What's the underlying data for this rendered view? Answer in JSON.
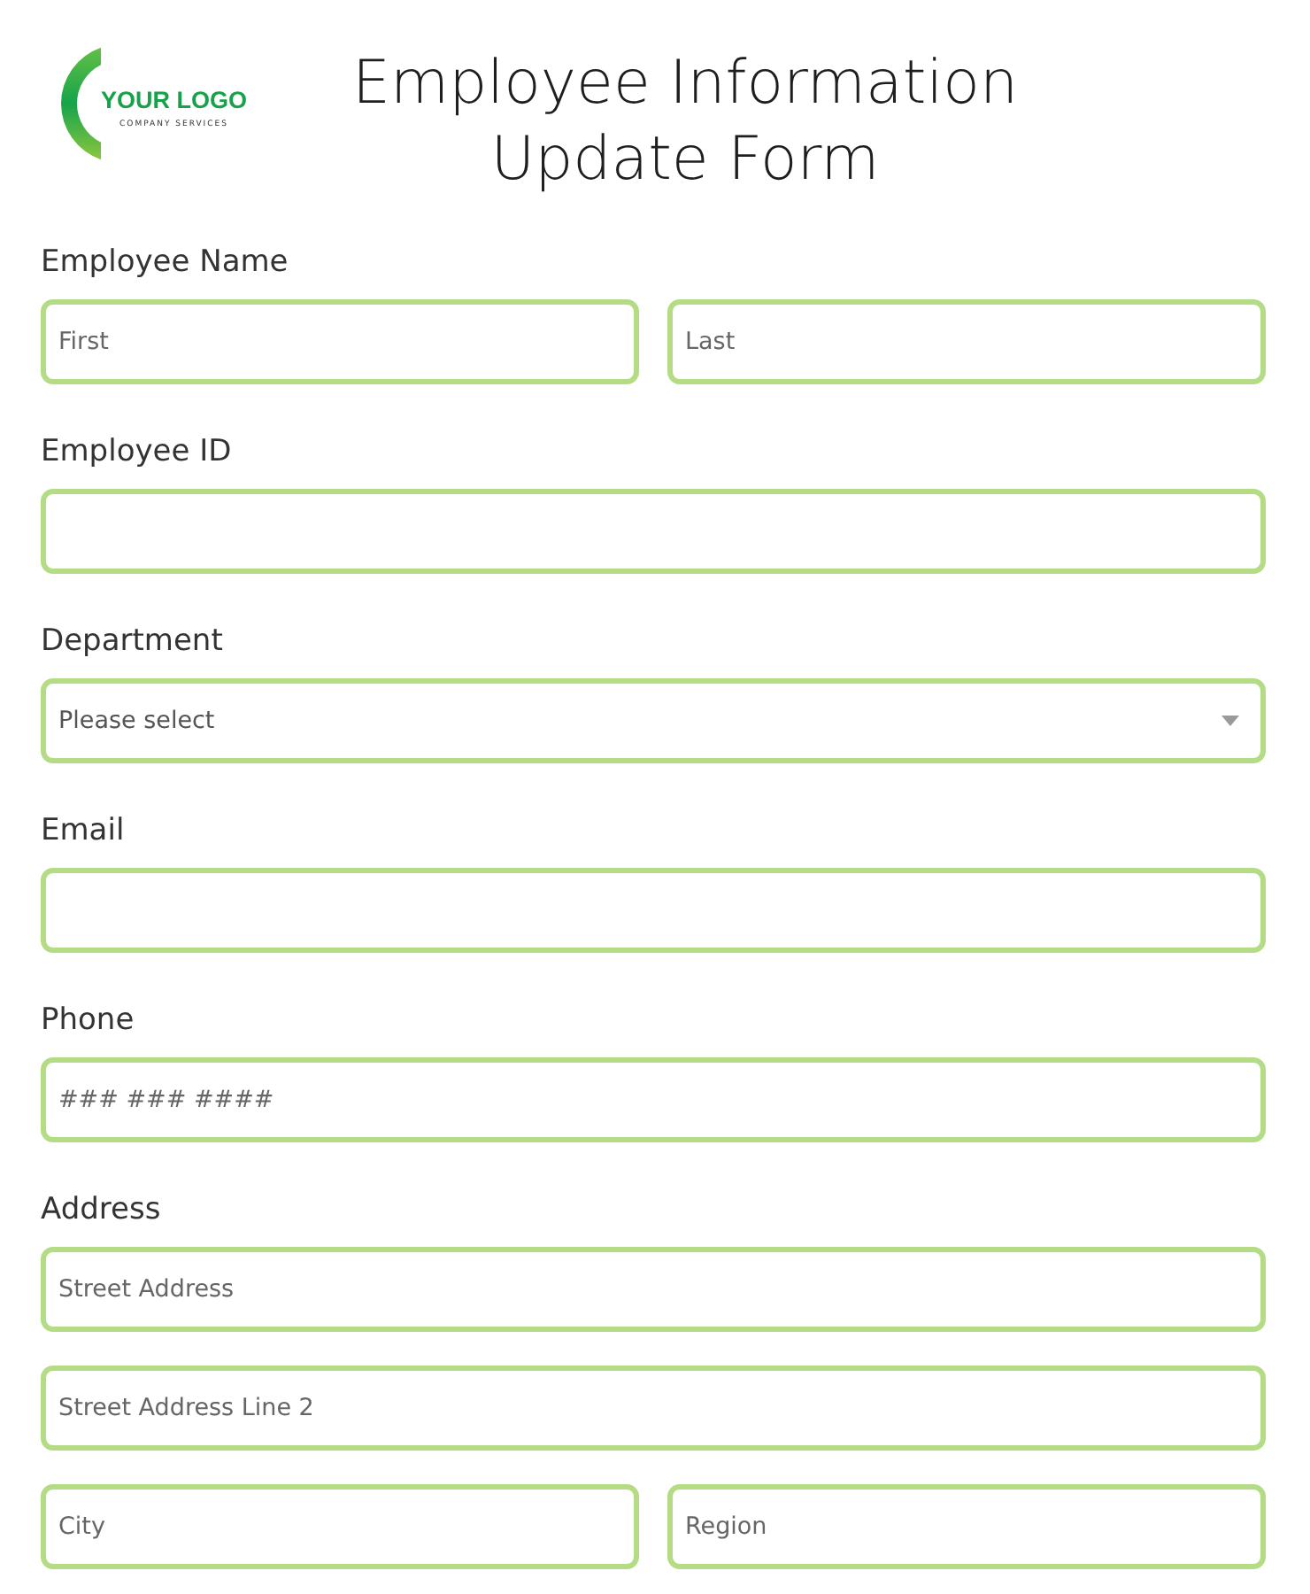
{
  "header": {
    "logo": {
      "name": "YOUR LOGO",
      "tagline": "COMPANY SERVICES"
    },
    "title": "Employee Information Update Form"
  },
  "sections": [
    {
      "label": "Employee Name",
      "rows": [
        [
          {
            "kind": "text",
            "placeholder": "First"
          },
          {
            "kind": "text",
            "placeholder": "Last"
          }
        ]
      ]
    },
    {
      "label": "Employee ID",
      "rows": [
        [
          {
            "kind": "text"
          }
        ]
      ]
    },
    {
      "label": "Department",
      "rows": [
        [
          {
            "kind": "select",
            "placeholder": "Please select"
          }
        ]
      ]
    },
    {
      "label": "Email",
      "rows": [
        [
          {
            "kind": "text"
          }
        ]
      ]
    },
    {
      "label": "Phone",
      "rows": [
        [
          {
            "kind": "text",
            "placeholder": "### ### ####"
          }
        ]
      ]
    },
    {
      "label": "Address",
      "rows": [
        [
          {
            "kind": "text",
            "placeholder": "Street Address"
          }
        ],
        [
          {
            "kind": "text",
            "placeholder": "Street Address Line 2"
          }
        ],
        [
          {
            "kind": "text",
            "placeholder": "City"
          },
          {
            "kind": "text",
            "placeholder": "Region"
          }
        ]
      ]
    }
  ]
}
